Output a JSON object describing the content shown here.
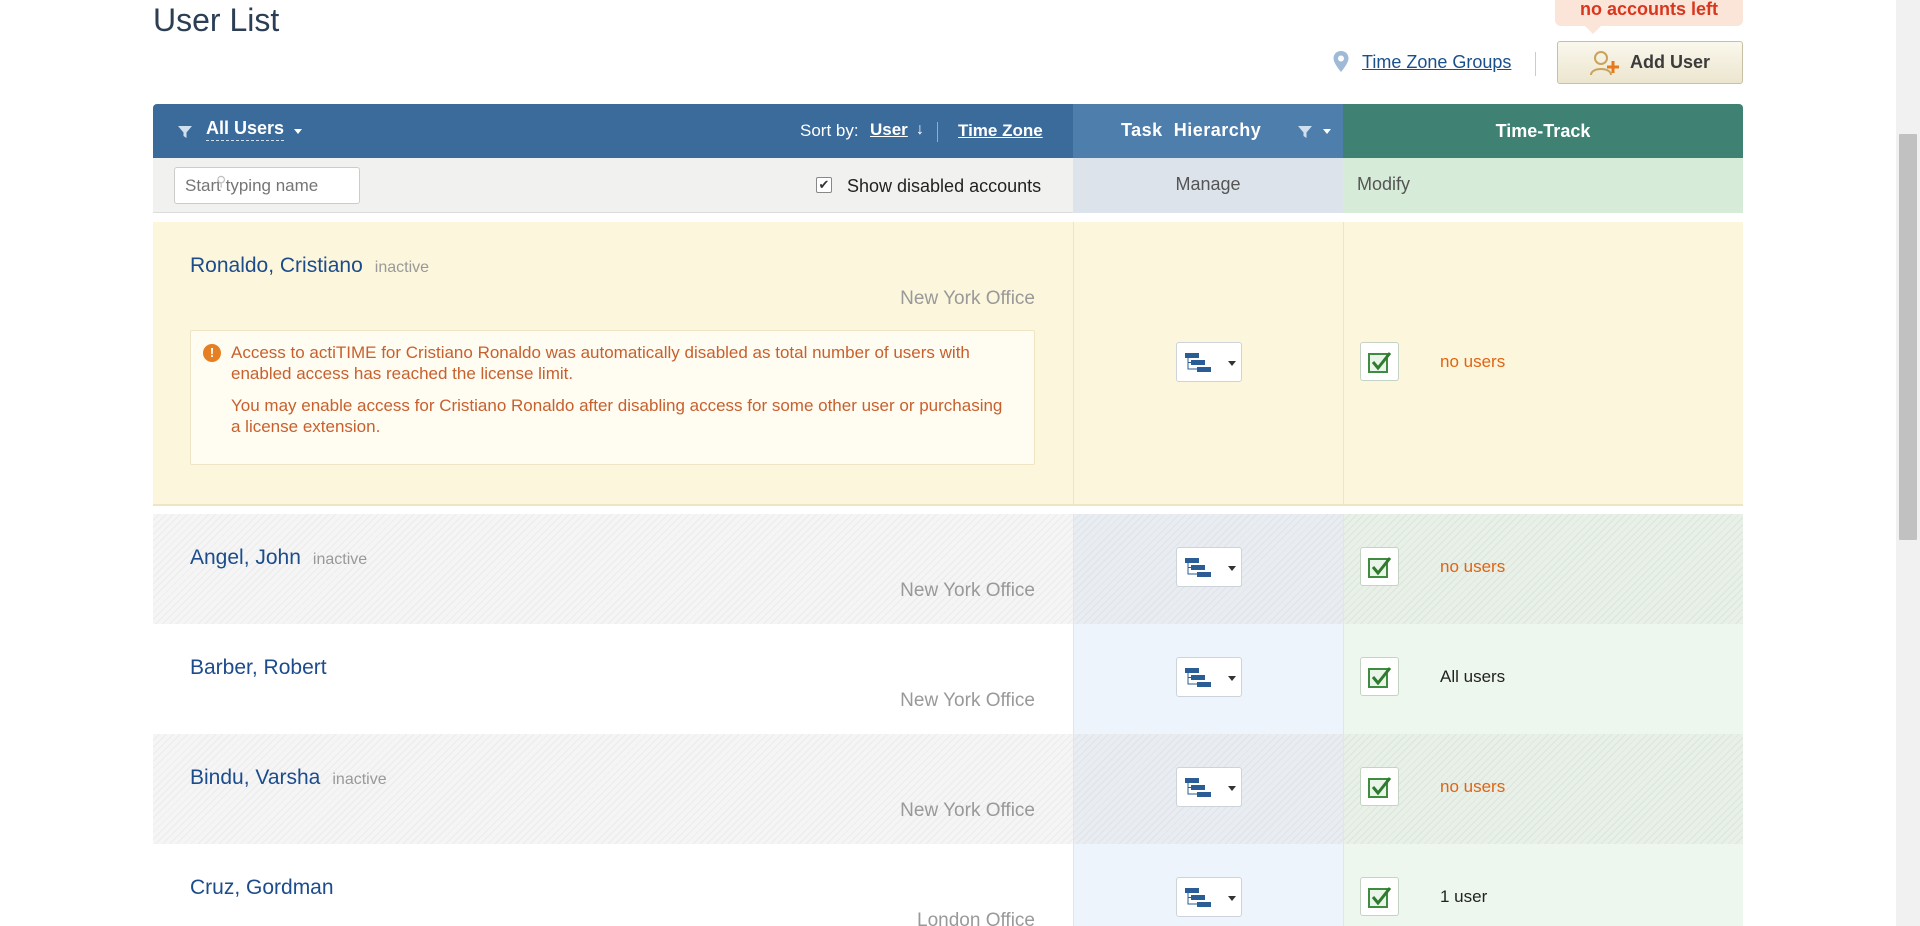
{
  "page": {
    "title": "User List",
    "license_notice": "no accounts left",
    "time_zone_groups_link": "Time Zone Groups",
    "add_user_label": "Add User"
  },
  "header": {
    "filter_label": "All Users",
    "sort_by_label": "Sort by:",
    "sort_user": "User",
    "sort_arrow": "↓",
    "sort_time_zone": "Time Zone",
    "task_hierarchy_label": "Task  Hierarchy",
    "time_track_label": "Time-Track"
  },
  "subheader": {
    "search_placeholder": "Start typing name",
    "show_disabled_label": "Show disabled accounts",
    "show_disabled_checked": true,
    "manage_label": "Manage",
    "modify_label": "Modify"
  },
  "alert": {
    "line1": "Access to actiTIME for Cristiano Ronaldo was automatically disabled as total number of users with enabled access has reached the license limit.",
    "line2": "You may enable access for Cristiano Ronaldo after disabling access for some other user or purchasing a license extension."
  },
  "users": [
    {
      "name": "Ronaldo, Cristiano",
      "status": "inactive",
      "office": "New York Office",
      "modify": "no users",
      "modify_color": "orange"
    },
    {
      "name": "Angel, John",
      "status": "inactive",
      "office": "New York Office",
      "modify": "no users",
      "modify_color": "orange"
    },
    {
      "name": "Barber, Robert",
      "status": "",
      "office": "New York Office",
      "modify": "All users",
      "modify_color": "dark"
    },
    {
      "name": "Bindu, Varsha",
      "status": "inactive",
      "office": "New York Office",
      "modify": "no users",
      "modify_color": "orange"
    },
    {
      "name": "Cruz, Gordman",
      "status": "",
      "office": "London Office",
      "modify": "1 user",
      "modify_color": "dark"
    }
  ],
  "colors": {
    "header_blue": "#3a6b9b",
    "header_teal": "#3f8173",
    "link_blue": "#1c4c8c",
    "warning_orange": "#e06412",
    "highlight_row": "#fcf6dd"
  },
  "icons": {
    "filter": "filter-icon",
    "pin": "map-pin-icon",
    "add_user": "add-user-icon",
    "hierarchy": "hierarchy-icon",
    "modify": "check-edit-icon",
    "alert": "exclamation-icon"
  }
}
